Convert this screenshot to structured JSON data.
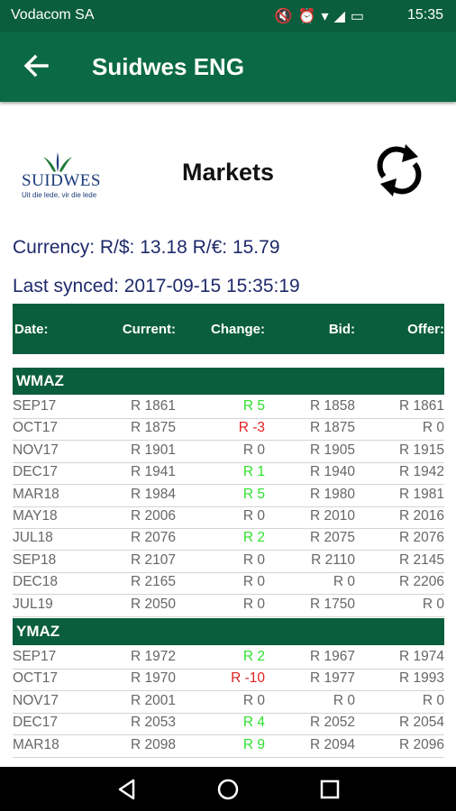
{
  "status_bar": {
    "carrier": "Vodacom SA",
    "time": "15:35",
    "icons": [
      "mute-icon",
      "alarm-icon",
      "wifi-icon",
      "signal-icon",
      "battery-icon"
    ]
  },
  "app_bar": {
    "title": "Suidwes ENG",
    "back_icon": "arrow-back-icon"
  },
  "logo": {
    "name": "SUIDWES",
    "tagline": "Uit die lede, vir die lede"
  },
  "page": {
    "title": "Markets",
    "refresh_icon": "refresh-icon"
  },
  "currency_text": "Currency: R/$: 13.18 R/€: 15.79",
  "last_synced_text": "Last synced: 2017-09-15 15:35:19",
  "table_header": {
    "date": "Date:",
    "current": "Current:",
    "change": "Change:",
    "bid": "Bid:",
    "offer": "Offer:"
  },
  "sections": [
    {
      "name": "WMAZ",
      "rows": [
        {
          "date": "SEP17",
          "current": "R 1861",
          "change": "R 5",
          "trend": "up",
          "bid": "R 1858",
          "offer": "R 1861"
        },
        {
          "date": "OCT17",
          "current": "R 1875",
          "change": "R -3",
          "trend": "down",
          "bid": "R 1875",
          "offer": "R 0"
        },
        {
          "date": "NOV17",
          "current": "R 1901",
          "change": "R 0",
          "trend": "none",
          "bid": "R 1905",
          "offer": "R 1915"
        },
        {
          "date": "DEC17",
          "current": "R 1941",
          "change": "R 1",
          "trend": "up",
          "bid": "R 1940",
          "offer": "R 1942"
        },
        {
          "date": "MAR18",
          "current": "R 1984",
          "change": "R 5",
          "trend": "up",
          "bid": "R 1980",
          "offer": "R 1981"
        },
        {
          "date": "MAY18",
          "current": "R 2006",
          "change": "R 0",
          "trend": "none",
          "bid": "R 2010",
          "offer": "R 2016"
        },
        {
          "date": "JUL18",
          "current": "R 2076",
          "change": "R 2",
          "trend": "up",
          "bid": "R 2075",
          "offer": "R 2076"
        },
        {
          "date": "SEP18",
          "current": "R 2107",
          "change": "R 0",
          "trend": "none",
          "bid": "R 2110",
          "offer": "R 2145"
        },
        {
          "date": "DEC18",
          "current": "R 2165",
          "change": "R 0",
          "trend": "none",
          "bid": "R 0",
          "offer": "R 2206"
        },
        {
          "date": "JUL19",
          "current": "R 2050",
          "change": "R 0",
          "trend": "none",
          "bid": "R 1750",
          "offer": "R 0"
        }
      ]
    },
    {
      "name": "YMAZ",
      "rows": [
        {
          "date": "SEP17",
          "current": "R 1972",
          "change": "R 2",
          "trend": "up",
          "bid": "R 1967",
          "offer": "R 1974"
        },
        {
          "date": "OCT17",
          "current": "R 1970",
          "change": "R -10",
          "trend": "down",
          "bid": "R 1977",
          "offer": "R 1993"
        },
        {
          "date": "NOV17",
          "current": "R 2001",
          "change": "R 0",
          "trend": "none",
          "bid": "R 0",
          "offer": "R 0"
        },
        {
          "date": "DEC17",
          "current": "R 2053",
          "change": "R 4",
          "trend": "up",
          "bid": "R 2052",
          "offer": "R 2054"
        },
        {
          "date": "MAR18",
          "current": "R 2098",
          "change": "R 9",
          "trend": "up",
          "bid": "R 2094",
          "offer": "R 2096"
        }
      ]
    }
  ],
  "colors": {
    "brand_green": "#0b6a45",
    "header_green": "#0b5e3d",
    "change_up": "#2ee02e",
    "change_down": "#e02020",
    "info_text": "#1f2a6b"
  },
  "nav_bar": {
    "icons": [
      "back-triangle-icon",
      "home-circle-icon",
      "recents-square-icon"
    ]
  }
}
